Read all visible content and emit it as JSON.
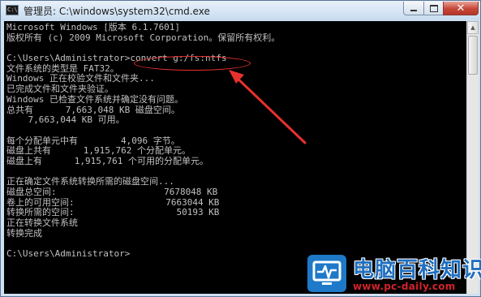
{
  "window": {
    "title": "管理员: C:\\windows\\system32\\cmd.exe",
    "app_icon": "C:\\",
    "buttons": {
      "minimize": "minimize-icon",
      "maximize": "maximize-icon",
      "close_label": "✕"
    }
  },
  "console": {
    "lines": [
      "Microsoft Windows [版本 6.1.7601]",
      "版权所有 (c) 2009 Microsoft Corporation。保留所有权利。",
      "",
      "C:\\Users\\Administrator>convert g:/fs:ntfs",
      "文件系统的类型是 FAT32。",
      "Windows 正在校验文件和文件夹...",
      "已完成文件和文件夹验证。",
      "Windows 已检查文件系统并确定没有问题。",
      "总共有      7,663,048 KB 磁盘空间。",
      "    7,663,044 KB 可用。",
      "",
      "每个分配单元中有        4,096 字节。",
      "磁盘上共有      1,915,762 个分配单元。",
      "磁盘上有      1,915,761 个可用的分配单元。",
      "",
      "正在确定文件系统转换所需的磁盘空间...",
      "磁盘总空间:                    7678048 KB",
      "卷上的可用空间:                 7663044 KB",
      "转换所需的空间:                   50193 KB",
      "正在转换文件系统",
      "转换完成",
      "",
      "C:\\Users\\Administrator>"
    ]
  },
  "annotation": {
    "color": "#e8312e"
  },
  "watermark": {
    "title": "电脑百科知识",
    "url": "www.pc-daily.com",
    "colors": {
      "title": "#1f6fc0",
      "url": "#d2232a",
      "logo": "#1e79c8"
    }
  }
}
